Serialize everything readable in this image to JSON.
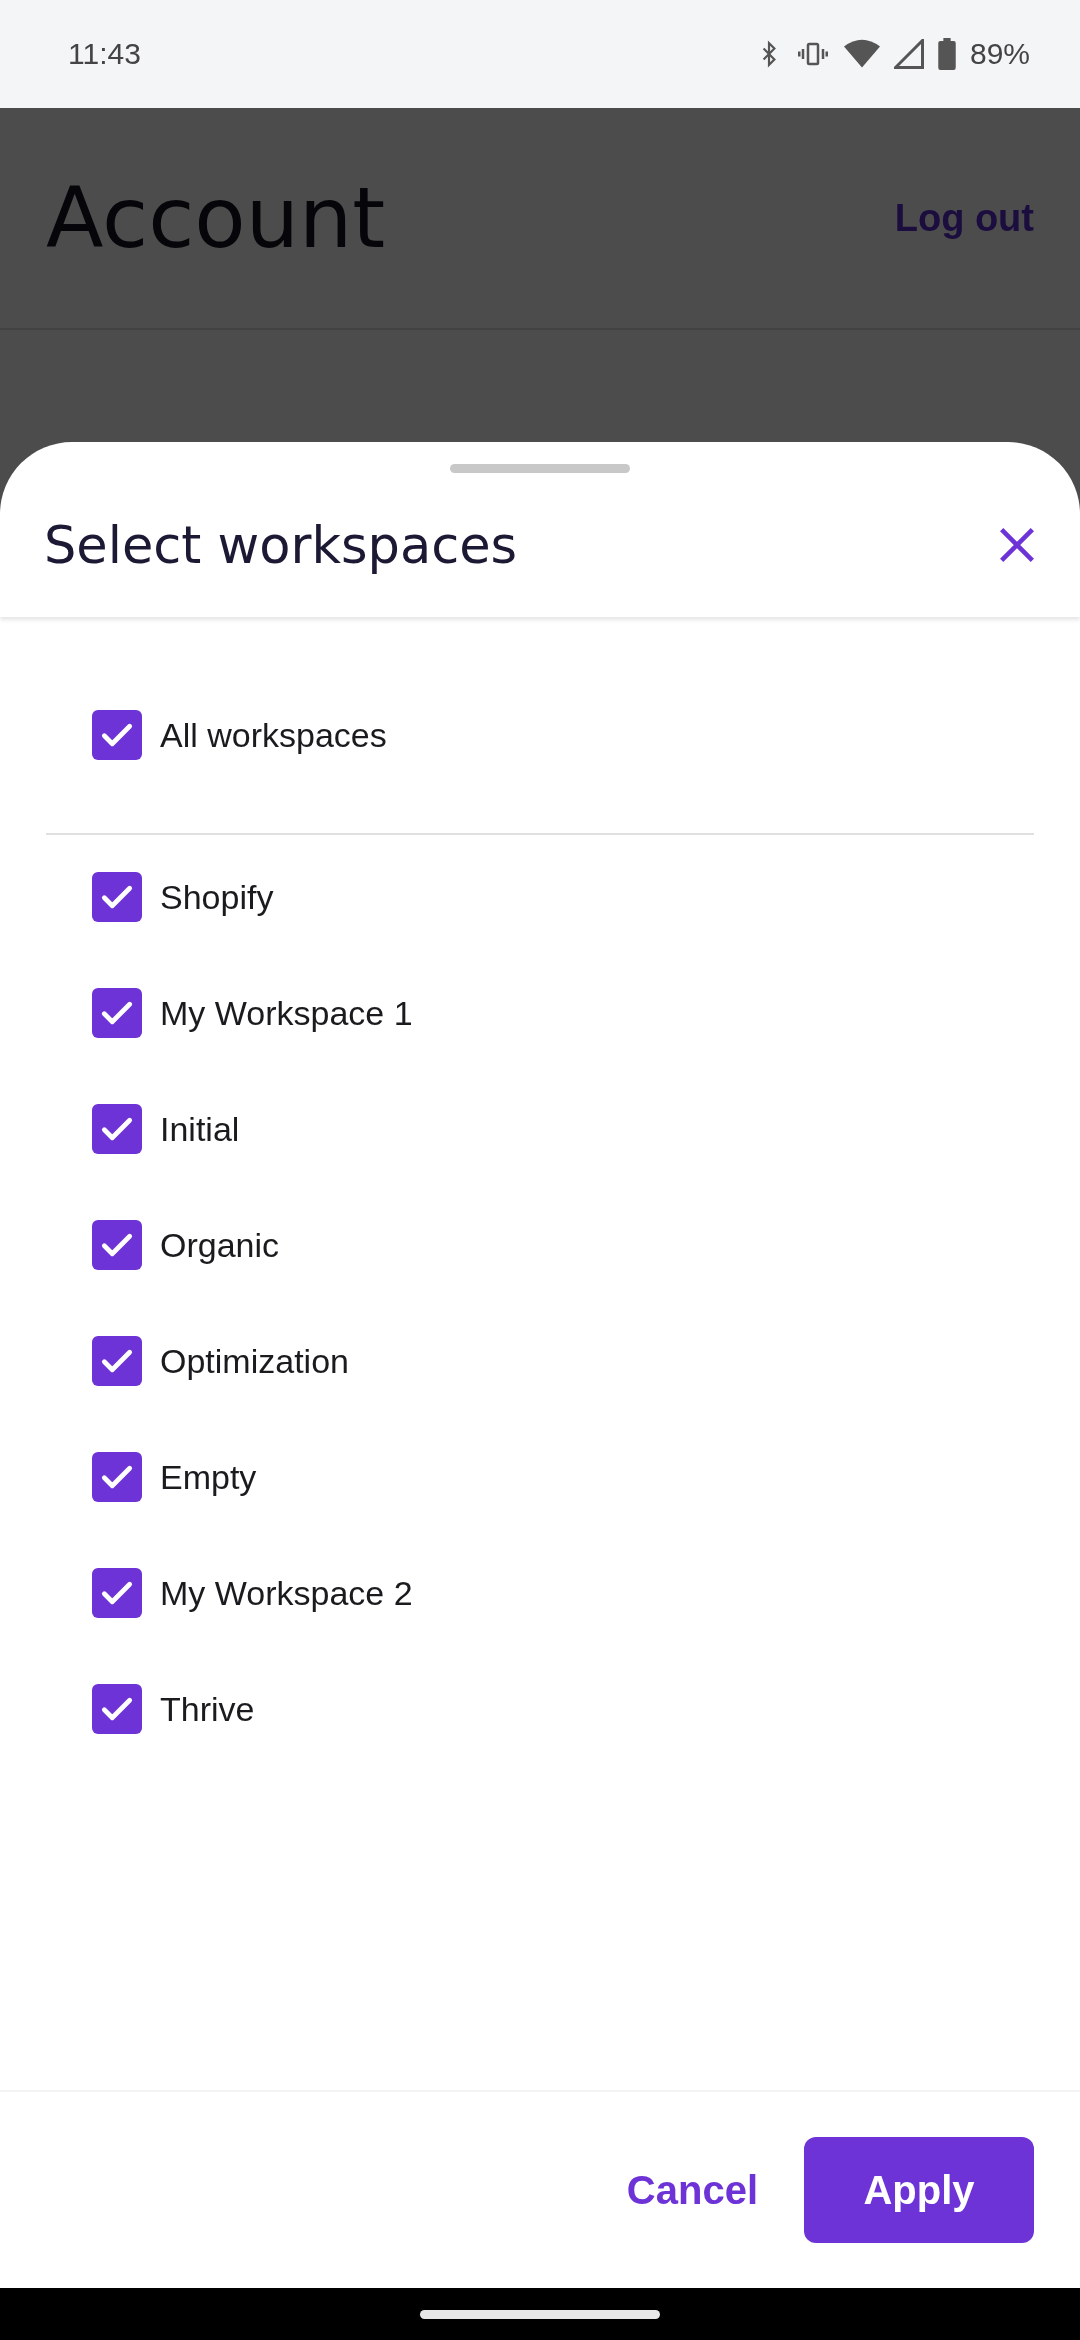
{
  "status_bar": {
    "time": "11:43",
    "battery": "89%"
  },
  "page": {
    "title": "Account",
    "action": "Log out"
  },
  "sheet": {
    "title": "Select workspaces",
    "all": {
      "label": "All workspaces",
      "checked": true
    },
    "workspaces": [
      {
        "label": "Shopify",
        "checked": true
      },
      {
        "label": "My Workspace 1",
        "checked": true
      },
      {
        "label": "Initial",
        "checked": true
      },
      {
        "label": "Organic",
        "checked": true
      },
      {
        "label": "Optimization",
        "checked": true
      },
      {
        "label": "Empty",
        "checked": true
      },
      {
        "label": "My Workspace 2",
        "checked": true
      },
      {
        "label": "Thrive",
        "checked": true
      }
    ],
    "cancel": "Cancel",
    "apply": "Apply"
  }
}
